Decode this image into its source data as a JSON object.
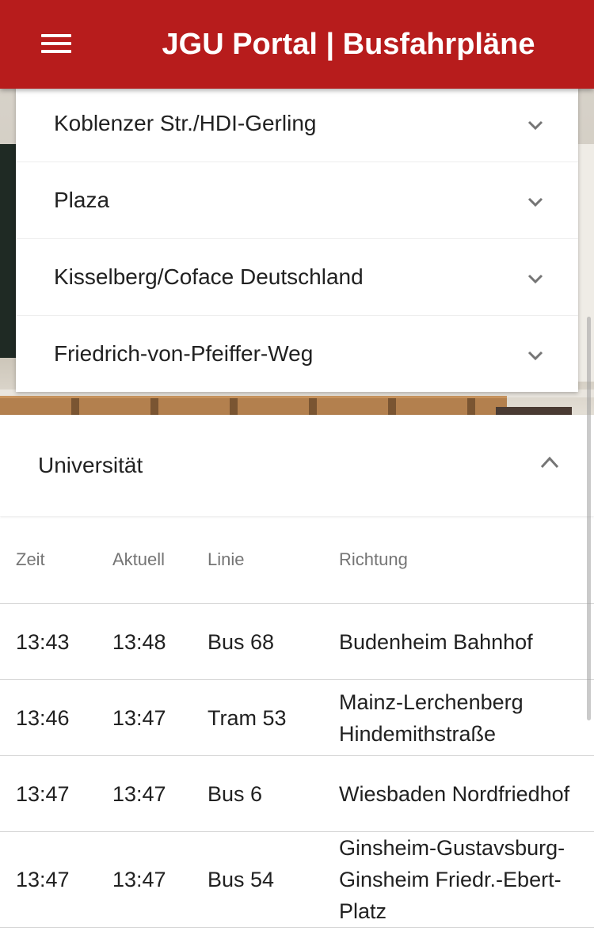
{
  "header": {
    "title": "JGU Portal | Busfahrpläne",
    "menu_icon": "hamburger-menu-icon"
  },
  "colors": {
    "accent": "#b71c1c"
  },
  "stops": [
    {
      "label": "Koblenzer Str./HDI-Gerling",
      "icon": "chevron-down-icon"
    },
    {
      "label": "Plaza",
      "icon": "chevron-down-icon"
    },
    {
      "label": "Kisselberg/Coface Deutschland",
      "icon": "chevron-down-icon"
    },
    {
      "label": "Friedrich-von-Pfeiffer-Weg",
      "icon": "chevron-down-icon"
    }
  ],
  "expanded_stop": {
    "label": "Universität",
    "icon": "chevron-up-icon",
    "columns": [
      "Zeit",
      "Aktuell",
      "Linie",
      "Richtung"
    ],
    "rows": [
      [
        "13:43",
        "13:48",
        "Bus 68",
        "Budenheim Bahnhof"
      ],
      [
        "13:46",
        "13:47",
        "Tram 53",
        "Mainz-Lerchenberg Hindemithstraße"
      ],
      [
        "13:47",
        "13:47",
        "Bus 6",
        "Wiesbaden Nordfriedhof"
      ],
      [
        "13:47",
        "13:47",
        "Bus 54",
        "Ginsheim-Gustavsburg-Ginsheim Friedr.-Ebert-Platz"
      ]
    ]
  }
}
